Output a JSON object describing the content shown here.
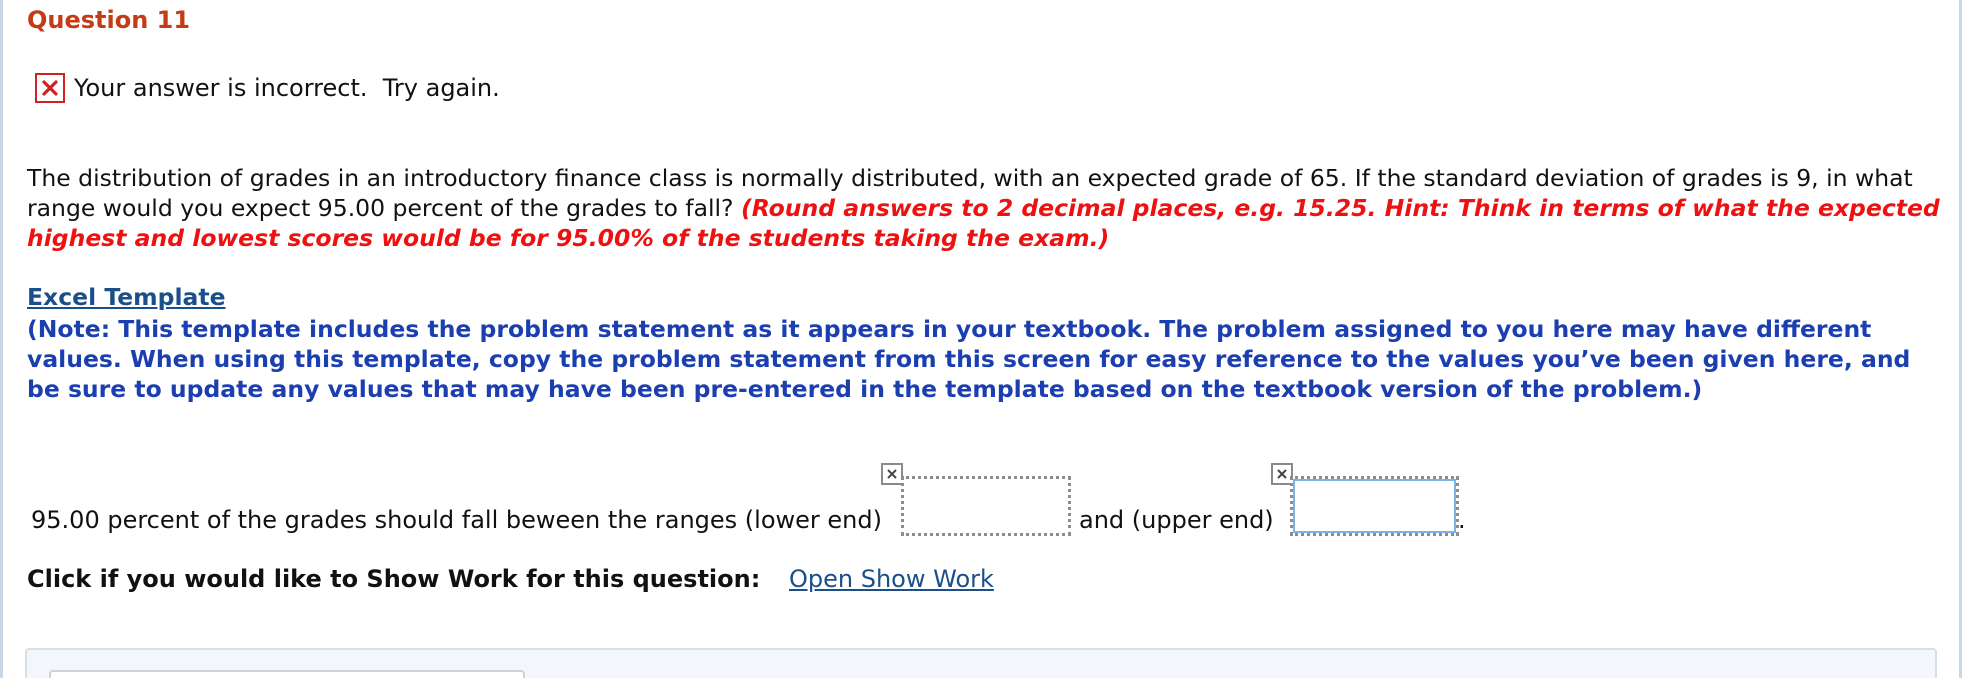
{
  "question": {
    "title": "Question 11"
  },
  "feedback": {
    "icon": "incorrect-x-icon",
    "message": "Your answer is incorrect.  Try again."
  },
  "problem": {
    "text": "The distribution of grades in an introductory finance class is normally distributed, with an expected grade of 65. If the standard deviation of grades is 9, in what range would you expect 95.00 percent of the grades to fall?",
    "hint": "(Round answers to 2 decimal places, e.g. 15.25. Hint: Think in terms of what the expected highest and lowest scores would be for 95.00% of the students taking the exam.)"
  },
  "excel": {
    "link_label": "Excel Template",
    "note": "(Note: This template includes the problem statement as it appears in your textbook. The problem assigned to you here may have different values. When using this template, copy the problem statement from this screen for easy reference to the values you’ve been given here, and be sure to update any values that may have been pre-entered in the template based on the textbook version of the problem.)"
  },
  "answer": {
    "prompt": "95.00 percent of the grades should fall beween the ranges (lower end)",
    "lower_value": "",
    "middle_label": "and (upper end)",
    "upper_value": "",
    "end_punct": "."
  },
  "show_work": {
    "label": "Click if you would like to Show Work for this question:",
    "link_label": "Open Show Work"
  },
  "colors": {
    "title": "#c43c16",
    "hint": "#ee1111",
    "note": "#1b3fb0",
    "link": "#1b4f8a",
    "incorrect": "#d32020"
  }
}
